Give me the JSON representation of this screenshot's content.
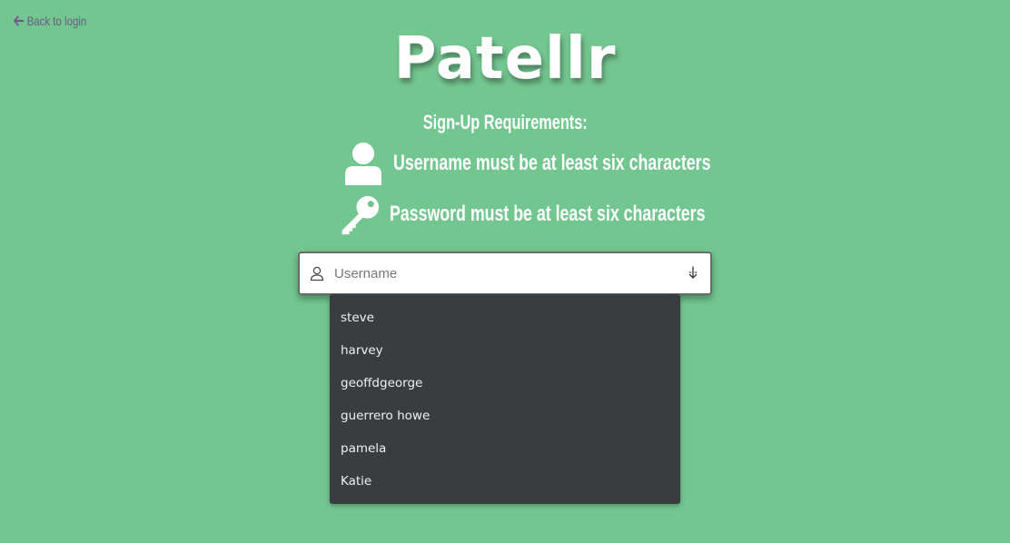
{
  "back_link": {
    "label": "Back to login",
    "icon": "arrow-left-icon"
  },
  "brand": {
    "title": "Patellr"
  },
  "requirements": {
    "title": "Sign-Up Requirements:",
    "items": [
      {
        "icon": "user-icon",
        "text": "Username must be at least six characters"
      },
      {
        "icon": "key-icon",
        "text": "Password must be at least six characters"
      }
    ]
  },
  "username_field": {
    "value": "",
    "placeholder": "Username",
    "leading_icon": "user-outline-icon",
    "trailing_icon": "autofill-key-icon"
  },
  "autocomplete": {
    "options": [
      "steve",
      "harvey",
      "geoffdgeorge",
      "guerrero howe",
      "pamela",
      "Katie"
    ]
  },
  "colors": {
    "background": "#74c690",
    "dropdown_bg": "#3a3d40",
    "back_link": "#6a5a86",
    "text_light": "#ffffff"
  }
}
